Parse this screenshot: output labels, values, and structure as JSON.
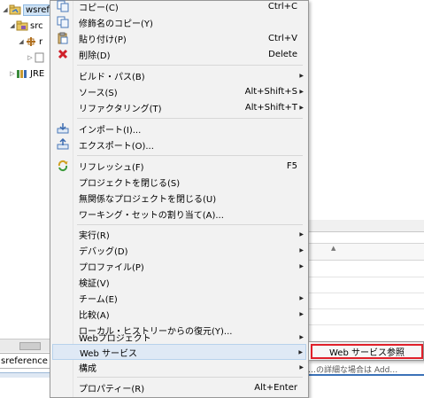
{
  "project_tree": {
    "project_label": "wsrefer",
    "src_label": "src",
    "package_label": "r",
    "jre_label": "JRE"
  },
  "bottom_panel": {
    "tab_label": "sreference",
    "partial_text": "…の詳細な場合は Add… "
  },
  "context_menu": {
    "items": [
      {
        "label": "コピー(C)",
        "shortcut": "Ctrl+C",
        "icon": "copy-icon"
      },
      {
        "label": "修飾名のコピー(Y)",
        "shortcut": "",
        "icon": "copy-qualified-icon"
      },
      {
        "label": "貼り付け(P)",
        "shortcut": "Ctrl+V",
        "icon": "paste-icon"
      },
      {
        "label": "削除(D)",
        "shortcut": "Delete",
        "icon": "delete-icon"
      },
      {
        "label": "ビルド・パス(B)",
        "shortcut": "",
        "icon": ""
      },
      {
        "label": "ソース(S)",
        "shortcut": "Alt+Shift+S",
        "icon": ""
      },
      {
        "label": "リファクタリング(T)",
        "shortcut": "Alt+Shift+T",
        "icon": ""
      },
      {
        "label": "インポート(I)...",
        "shortcut": "",
        "icon": "import-icon"
      },
      {
        "label": "エクスポート(O)...",
        "shortcut": "",
        "icon": "export-icon"
      },
      {
        "label": "リフレッシュ(F)",
        "shortcut": "F5",
        "icon": "refresh-icon"
      },
      {
        "label": "プロジェクトを閉じる(S)",
        "shortcut": "",
        "icon": ""
      },
      {
        "label": "無関係なプロジェクトを閉じる(U)",
        "shortcut": "",
        "icon": ""
      },
      {
        "label": "ワーキング・セットの割り当て(A)...",
        "shortcut": "",
        "icon": ""
      },
      {
        "label": "実行(R)",
        "shortcut": "",
        "icon": ""
      },
      {
        "label": "デバッグ(D)",
        "shortcut": "",
        "icon": ""
      },
      {
        "label": "プロファイル(P)",
        "shortcut": "",
        "icon": ""
      },
      {
        "label": "検証(V)",
        "shortcut": "",
        "icon": ""
      },
      {
        "label": "チーム(E)",
        "shortcut": "",
        "icon": ""
      },
      {
        "label": "比較(A)",
        "shortcut": "",
        "icon": ""
      },
      {
        "label": "ローカル・ヒストリーからの復元(Y)...",
        "shortcut": "",
        "icon": ""
      },
      {
        "label": "Webプロジェクト",
        "shortcut": "",
        "icon": ""
      },
      {
        "label": "Web サービス",
        "shortcut": "",
        "icon": ""
      },
      {
        "label": "構成",
        "shortcut": "",
        "icon": ""
      },
      {
        "label": "プロパティー(R)",
        "shortcut": "Alt+Enter",
        "icon": ""
      }
    ]
  },
  "submenu": {
    "item_label": "Web サービス参照"
  },
  "colors": {
    "highlight": "#dfe9f5",
    "submenu_border": "#e0202a",
    "delete_icon": "#d0202a"
  }
}
